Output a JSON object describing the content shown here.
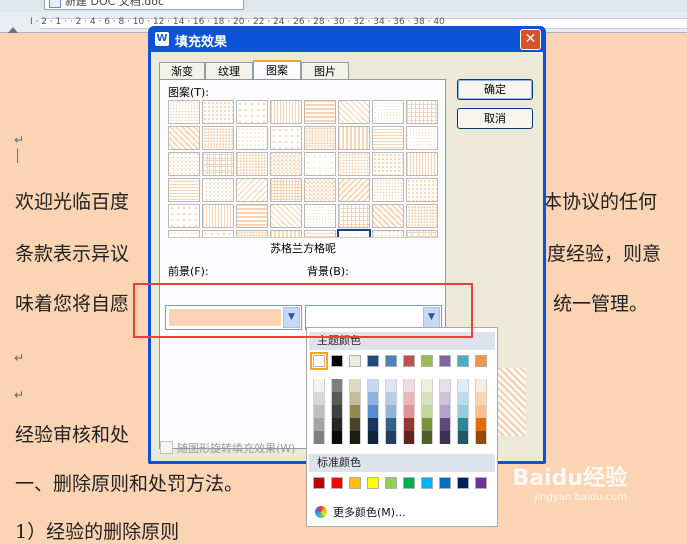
{
  "window": {
    "doc_tab_title": "新建 DOC 文档.doc"
  },
  "ruler": {
    "numbers": "I · 2 · 1 · · 2 · 4 · 6 · 8 · 10 · 12 · 14 · 16 · 18 · 20 · 22 · 24 · 26 · 28 · 30 · 32 · 34 · 36 · 38 · 40"
  },
  "document": {
    "para1_left": "欢迎光临百度",
    "para1_right": "本协议的任何",
    "para2_left": "条款表示异议",
    "para2_right": "度经验，则意",
    "para3_left": "味着您将自愿",
    "para3_right": "统一管理。",
    "para4": "经验审核和处",
    "para5": "一、删除原则和处罚方法。",
    "para6": "1）经验的删除原则"
  },
  "dialog": {
    "title": "填充效果",
    "close_glyph": "✕",
    "tabs": [
      {
        "label": "渐变"
      },
      {
        "label": "纹理"
      },
      {
        "label": "图案",
        "active": true
      },
      {
        "label": "图片"
      }
    ],
    "pattern_label": "图案(T):",
    "pattern_count": 48,
    "selected_pattern_index": 45,
    "pattern_name": "苏格兰方格呢",
    "foreground_label": "前景(F):",
    "background_label": "背景(B):",
    "foreground_color": "#fbd4b4",
    "background_color": "#ffffff",
    "ok_label": "确定",
    "cancel_label": "取消",
    "rotate_checkbox_label": "随图形旋转填充效果(W)"
  },
  "color_popup": {
    "theme_header": "主题颜色",
    "theme_colors": [
      "#ffffff",
      "#000000",
      "#eeece1",
      "#1f497d",
      "#4f81bd",
      "#c0504d",
      "#9bbb59",
      "#8064a2",
      "#4bacc6",
      "#f79646"
    ],
    "tint_rows": [
      [
        "#f2f2f2",
        "#7f7f7f",
        "#ddd9c3",
        "#c6d9f0",
        "#dbe5f1",
        "#f2dcdb",
        "#ebf1dd",
        "#e5e0ec",
        "#dbeef3",
        "#fdeada"
      ],
      [
        "#d8d8d8",
        "#595959",
        "#c4bd97",
        "#8db3e2",
        "#b8cce4",
        "#e5b9b7",
        "#d7e3bc",
        "#ccc1d9",
        "#b7dde8",
        "#fbd5b5"
      ],
      [
        "#bfbfbf",
        "#3f3f3f",
        "#938953",
        "#548dd4",
        "#95b3d7",
        "#d99694",
        "#c3d69b",
        "#b2a2c7",
        "#92cddc",
        "#fac08f"
      ],
      [
        "#a5a5a5",
        "#262626",
        "#494429",
        "#17365d",
        "#366092",
        "#953734",
        "#76923c",
        "#5f497a",
        "#31859b",
        "#e36c09"
      ],
      [
        "#7f7f7f",
        "#0c0c0c",
        "#1d1b10",
        "#0f243e",
        "#244061",
        "#632423",
        "#4f6128",
        "#3f3151",
        "#205867",
        "#974806"
      ]
    ],
    "standard_header": "标准颜色",
    "standard_colors": [
      "#c00000",
      "#ff0000",
      "#ffc000",
      "#ffff00",
      "#92d050",
      "#00b050",
      "#00b0f0",
      "#0070c0",
      "#002060",
      "#7030a0"
    ],
    "more_colors_label": "更多颜色(M)..."
  },
  "watermark": {
    "text": "Baidu经验",
    "sub": "jingyan.baidu.com"
  }
}
